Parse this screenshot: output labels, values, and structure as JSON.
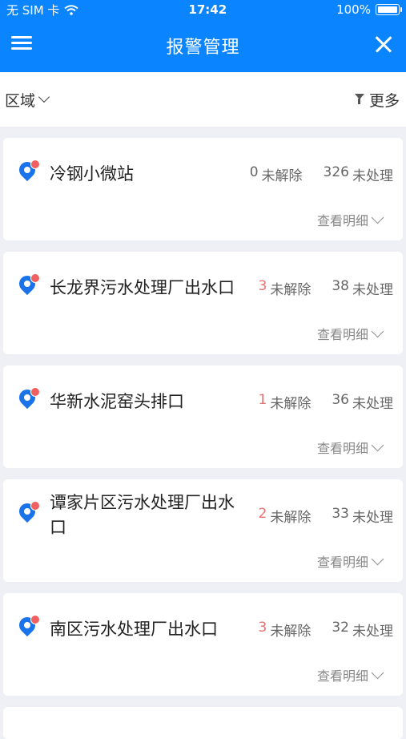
{
  "status": {
    "carrier": "无 SIM 卡",
    "time": "17:42",
    "battery": "100%"
  },
  "header": {
    "title": "报警管理"
  },
  "filter": {
    "region_label": "区域",
    "more_label": "更多"
  },
  "labels": {
    "unresolved": "未解除",
    "unprocessed": "未处理",
    "detail": "查看明细"
  },
  "stations": [
    {
      "name": "冷钢小微站",
      "unresolved": "0",
      "unprocessed": "326"
    },
    {
      "name": "长龙界污水处理厂出水口",
      "unresolved": "3",
      "unprocessed": "38"
    },
    {
      "name": "华新水泥窑头排口",
      "unresolved": "1",
      "unprocessed": "36"
    },
    {
      "name": "谭家片区污水处理厂出水口",
      "unresolved": "2",
      "unprocessed": "33"
    },
    {
      "name": "南区污水处理厂出水口",
      "unresolved": "3",
      "unprocessed": "32"
    }
  ]
}
